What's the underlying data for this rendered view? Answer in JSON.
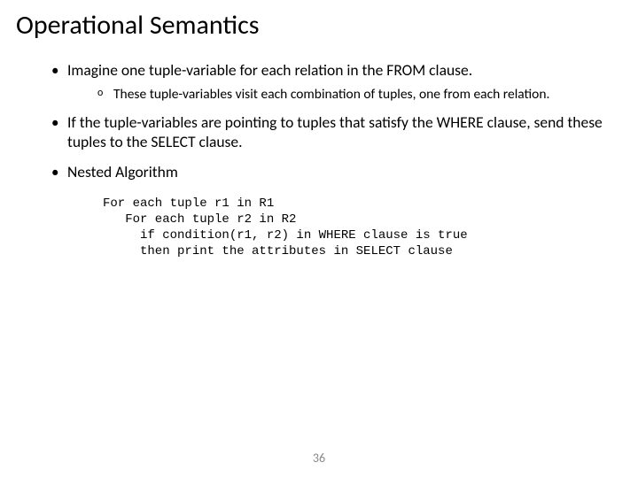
{
  "title": "Operational Semantics",
  "bullets": {
    "b1": "Imagine one tuple-variable for each relation in the FROM clause.",
    "b1sub": "These tuple-variables visit each combination of tuples, one from each relation.",
    "b2": "If the tuple-variables are pointing to tuples that satisfy the WHERE clause, send these tuples to the SELECT clause.",
    "b3": "Nested Algorithm"
  },
  "code": "For each tuple r1 in R1\n   For each tuple r2 in R2\n     if condition(r1, r2) in WHERE clause is true\n     then print the attributes in SELECT clause",
  "page_number": "36"
}
